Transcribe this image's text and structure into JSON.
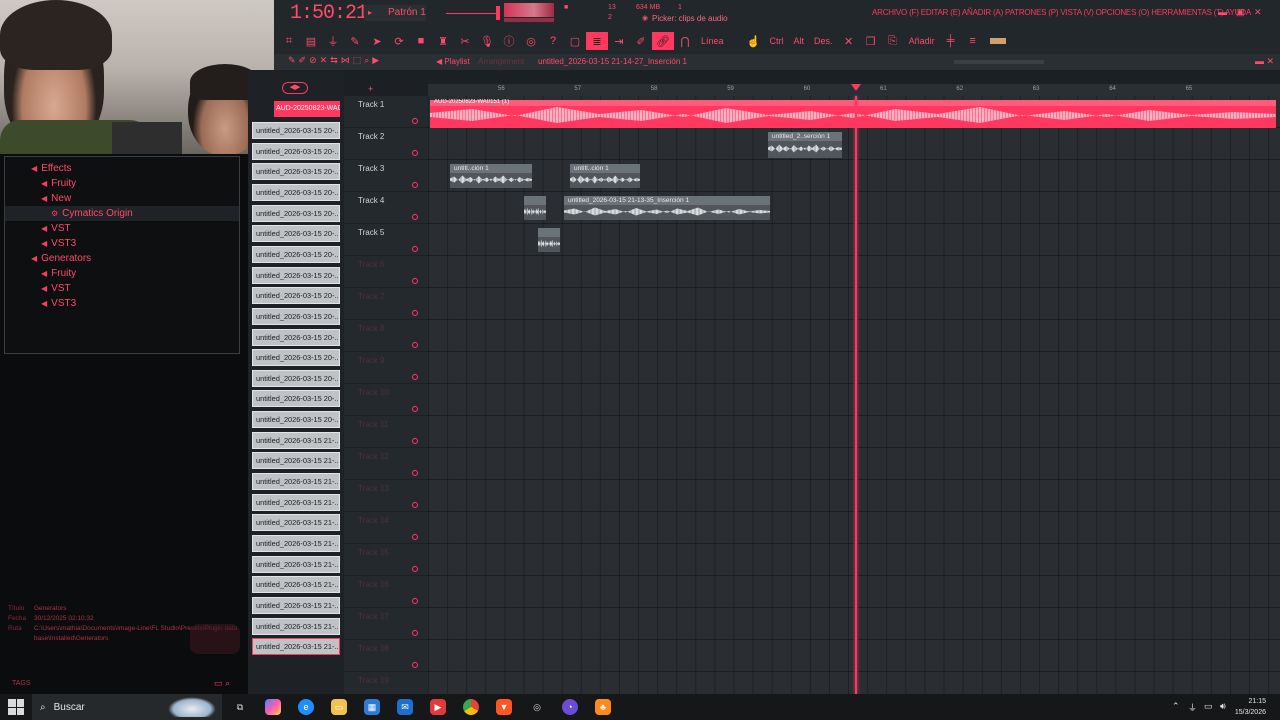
{
  "app": {
    "time": "1:50:21",
    "pattern": "Patrón 1",
    "memory": "634 MB",
    "small_value": "1",
    "cpu_value": "13",
    "polyphony_value": "2",
    "hint": "Picker: clips de audio",
    "menu": "ARCHIVO (F) EDITAR (E) AÑADIR (A) PATRONES (P) VISTA (V) OPCIONES (O) HERRAMIENTAS (T) AYUDA",
    "snap_label": "Línea",
    "toolbar_text": [
      "Ctrl",
      "Alt",
      "Des.",
      "Añadir"
    ]
  },
  "browser": {
    "tree": [
      {
        "label": "Effects",
        "level": 0
      },
      {
        "label": "Fruity",
        "level": 1
      },
      {
        "label": "New",
        "level": 1
      },
      {
        "label": "Cymatics Origin",
        "level": 2,
        "selected": true
      },
      {
        "label": "VST",
        "level": 1
      },
      {
        "label": "VST3",
        "level": 1
      },
      {
        "label": "Generators",
        "level": 0
      },
      {
        "label": "Fruity",
        "level": 1
      },
      {
        "label": "VST",
        "level": 1
      },
      {
        "label": "VST3",
        "level": 1
      }
    ],
    "info": {
      "title_label": "Título",
      "title_value": "Generators",
      "date_label": "Fecha",
      "date_value": "30/12/2025 02:10:32",
      "path_label": "Ruta",
      "path_value": "C:\\Users\\mathia\\Documents\\Image-Line\\FL Studio\\Presets\\Plugin database\\Installed\\Generators"
    },
    "tags_label": "TAGS"
  },
  "playlist": {
    "title": "Playlist",
    "breadcrumb": "Arrangement",
    "file": "untitled_2026-03-15 21-14-27_Inserción 1",
    "header_clip": "AUD-20250823-WA01...",
    "clips": [
      "untitled_2026-03-15 20-...",
      "untitled_2026-03-15 20-...",
      "untitled_2026-03-15 20-...",
      "untitled_2026-03-15 20-...",
      "untitled_2026-03-15 20-...",
      "untitled_2026-03-15 20-...",
      "untitled_2026-03-15 20-...",
      "untitled_2026-03-15 20-...",
      "untitled_2026-03-15 20-...",
      "untitled_2026-03-15 20-...",
      "untitled_2026-03-15 20-...",
      "untitled_2026-03-15 20-...",
      "untitled_2026-03-15 20-...",
      "untitled_2026-03-15 20-...",
      "untitled_2026-03-15 20-...",
      "untitled_2026-03-15 21-...",
      "untitled_2026-03-15 21-...",
      "untitled_2026-03-15 21-...",
      "untitled_2026-03-15 21-...",
      "untitled_2026-03-15 21-...",
      "untitled_2026-03-15 21-...",
      "untitled_2026-03-15 21-...",
      "untitled_2026-03-15 21-...",
      "untitled_2026-03-15 21-...",
      "untitled_2026-03-15 21-...",
      "untitled_2026-03-15 21-..."
    ],
    "tracks": [
      "Track 1",
      "Track 2",
      "Track 3",
      "Track 4",
      "Track 5",
      "Track 6",
      "Track 7",
      "Track 8",
      "Track 9",
      "Track 10",
      "Track 11",
      "Track 12",
      "Track 13",
      "Track 14",
      "Track 15",
      "Track 16",
      "Track 17",
      "Track 18",
      "Track 19"
    ],
    "ruler": [
      "56",
      "57",
      "58",
      "59",
      "60",
      "61",
      "62",
      "63",
      "64",
      "65"
    ],
    "audio_clips": [
      {
        "label": "AUD-20250823-WA0151 (1)",
        "track": 1,
        "big": true
      },
      {
        "label": "untitled_2..serción 1",
        "track": 2
      },
      {
        "label": "untitl..ción 1",
        "track": 3
      },
      {
        "label": "untitl..ción 1",
        "track": 3
      },
      {
        "label": "",
        "track": 4
      },
      {
        "label": "untitled_2026-03-15 21-13-35_Inserción 1",
        "track": 4
      },
      {
        "label": "",
        "track": 5
      }
    ]
  },
  "taskbar": {
    "search": "Buscar",
    "time": "21:15",
    "date": "15/3/2026"
  },
  "colors": {
    "accent": "#ff3860",
    "background": "#1c2024"
  }
}
